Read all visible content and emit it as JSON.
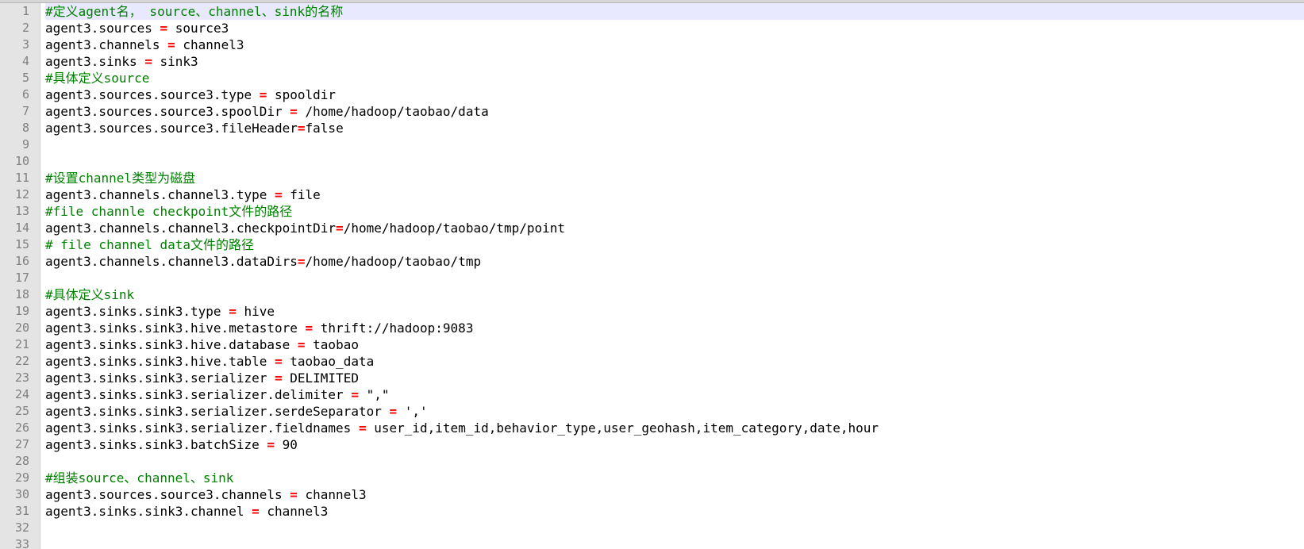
{
  "editor": {
    "current_line": 1,
    "colors": {
      "comment": "#008000",
      "operator": "#ff0000",
      "default": "#000000",
      "line_number": "#808080",
      "current_line_bg": "#e8e8ff",
      "gutter_bg": "#e4e4e4"
    },
    "lines": [
      {
        "number": "1",
        "segments": [
          {
            "type": "comment",
            "text": "#定义agent名， source、channel、sink的名称"
          }
        ]
      },
      {
        "number": "2",
        "segments": [
          {
            "type": "default",
            "text": "agent3.sources "
          },
          {
            "type": "op",
            "text": "="
          },
          {
            "type": "default",
            "text": " source3"
          }
        ]
      },
      {
        "number": "3",
        "segments": [
          {
            "type": "default",
            "text": "agent3.channels "
          },
          {
            "type": "op",
            "text": "="
          },
          {
            "type": "default",
            "text": " channel3"
          }
        ]
      },
      {
        "number": "4",
        "segments": [
          {
            "type": "default",
            "text": "agent3.sinks "
          },
          {
            "type": "op",
            "text": "="
          },
          {
            "type": "default",
            "text": " sink3"
          }
        ]
      },
      {
        "number": "5",
        "segments": [
          {
            "type": "comment",
            "text": "#具体定义source"
          }
        ]
      },
      {
        "number": "6",
        "segments": [
          {
            "type": "default",
            "text": "agent3.sources.source3.type "
          },
          {
            "type": "op",
            "text": "="
          },
          {
            "type": "default",
            "text": " spooldir"
          }
        ]
      },
      {
        "number": "7",
        "segments": [
          {
            "type": "default",
            "text": "agent3.sources.source3.spoolDir "
          },
          {
            "type": "op",
            "text": "="
          },
          {
            "type": "default",
            "text": " /home/hadoop/taobao/data"
          }
        ]
      },
      {
        "number": "8",
        "segments": [
          {
            "type": "default",
            "text": "agent3.sources.source3.fileHeader"
          },
          {
            "type": "op",
            "text": "="
          },
          {
            "type": "default",
            "text": "false"
          }
        ]
      },
      {
        "number": "9",
        "segments": []
      },
      {
        "number": "10",
        "segments": []
      },
      {
        "number": "11",
        "segments": [
          {
            "type": "comment",
            "text": "#设置channel类型为磁盘"
          }
        ]
      },
      {
        "number": "12",
        "segments": [
          {
            "type": "default",
            "text": "agent3.channels.channel3.type "
          },
          {
            "type": "op",
            "text": "="
          },
          {
            "type": "default",
            "text": " file"
          }
        ]
      },
      {
        "number": "13",
        "segments": [
          {
            "type": "comment",
            "text": "#file channle checkpoint文件的路径"
          }
        ]
      },
      {
        "number": "14",
        "segments": [
          {
            "type": "default",
            "text": "agent3.channels.channel3.checkpointDir"
          },
          {
            "type": "op",
            "text": "="
          },
          {
            "type": "default",
            "text": "/home/hadoop/taobao/tmp/point"
          }
        ]
      },
      {
        "number": "15",
        "segments": [
          {
            "type": "comment",
            "text": "# file channel data文件的路径"
          }
        ]
      },
      {
        "number": "16",
        "segments": [
          {
            "type": "default",
            "text": "agent3.channels.channel3.dataDirs"
          },
          {
            "type": "op",
            "text": "="
          },
          {
            "type": "default",
            "text": "/home/hadoop/taobao/tmp"
          }
        ]
      },
      {
        "number": "17",
        "segments": []
      },
      {
        "number": "18",
        "segments": [
          {
            "type": "comment",
            "text": "#具体定义sink"
          }
        ]
      },
      {
        "number": "19",
        "segments": [
          {
            "type": "default",
            "text": "agent3.sinks.sink3.type "
          },
          {
            "type": "op",
            "text": "="
          },
          {
            "type": "default",
            "text": " hive"
          }
        ]
      },
      {
        "number": "20",
        "segments": [
          {
            "type": "default",
            "text": "agent3.sinks.sink3.hive.metastore "
          },
          {
            "type": "op",
            "text": "="
          },
          {
            "type": "default",
            "text": " thrift://hadoop:9083"
          }
        ]
      },
      {
        "number": "21",
        "segments": [
          {
            "type": "default",
            "text": "agent3.sinks.sink3.hive.database "
          },
          {
            "type": "op",
            "text": "="
          },
          {
            "type": "default",
            "text": " taobao"
          }
        ]
      },
      {
        "number": "22",
        "segments": [
          {
            "type": "default",
            "text": "agent3.sinks.sink3.hive.table "
          },
          {
            "type": "op",
            "text": "="
          },
          {
            "type": "default",
            "text": " taobao_data"
          }
        ]
      },
      {
        "number": "23",
        "segments": [
          {
            "type": "default",
            "text": "agent3.sinks.sink3.serializer "
          },
          {
            "type": "op",
            "text": "="
          },
          {
            "type": "default",
            "text": " DELIMITED"
          }
        ]
      },
      {
        "number": "24",
        "segments": [
          {
            "type": "default",
            "text": "agent3.sinks.sink3.serializer.delimiter "
          },
          {
            "type": "op",
            "text": "="
          },
          {
            "type": "default",
            "text": " \",\""
          }
        ]
      },
      {
        "number": "25",
        "segments": [
          {
            "type": "default",
            "text": "agent3.sinks.sink3.serializer.serdeSeparator "
          },
          {
            "type": "op",
            "text": "="
          },
          {
            "type": "default",
            "text": " ','"
          }
        ]
      },
      {
        "number": "26",
        "segments": [
          {
            "type": "default",
            "text": "agent3.sinks.sink3.serializer.fieldnames "
          },
          {
            "type": "op",
            "text": "="
          },
          {
            "type": "default",
            "text": " user_id,item_id,behavior_type,user_geohash,item_category,date,hour"
          }
        ]
      },
      {
        "number": "27",
        "segments": [
          {
            "type": "default",
            "text": "agent3.sinks.sink3.batchSize "
          },
          {
            "type": "op",
            "text": "="
          },
          {
            "type": "default",
            "text": " 90"
          }
        ]
      },
      {
        "number": "28",
        "segments": []
      },
      {
        "number": "29",
        "segments": [
          {
            "type": "comment",
            "text": "#组装source、channel、sink"
          }
        ]
      },
      {
        "number": "30",
        "segments": [
          {
            "type": "default",
            "text": "agent3.sources.source3.channels "
          },
          {
            "type": "op",
            "text": "="
          },
          {
            "type": "default",
            "text": " channel3"
          }
        ]
      },
      {
        "number": "31",
        "segments": [
          {
            "type": "default",
            "text": "agent3.sinks.sink3.channel "
          },
          {
            "type": "op",
            "text": "="
          },
          {
            "type": "default",
            "text": " channel3"
          }
        ]
      },
      {
        "number": "32",
        "segments": []
      },
      {
        "number": "33",
        "segments": []
      }
    ]
  }
}
